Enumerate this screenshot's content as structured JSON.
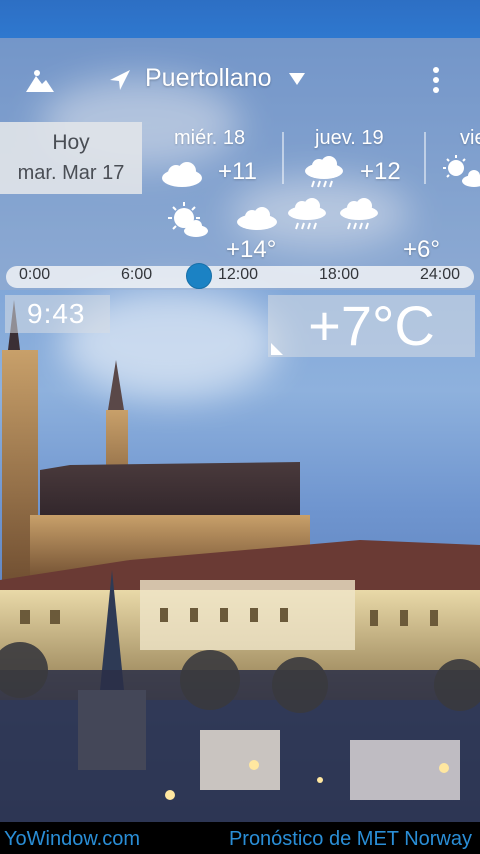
{
  "header": {
    "location": "Puertollano"
  },
  "days": [
    {
      "name": "Hoy",
      "date": "mar. Mar 17"
    },
    {
      "name": "miér. 18",
      "temp": "+11",
      "icon": "cloud-icon"
    },
    {
      "name": "juev. 19",
      "temp": "+12",
      "icon": "rain-cloud-icon"
    },
    {
      "name": "vie",
      "icon": "sun-cloud-icon"
    }
  ],
  "hourly": {
    "high_temp": "+14°",
    "low_temp": "+6°",
    "icons": [
      "sun-cloud-icon",
      "cloud-icon",
      "rain-cloud-icon",
      "rain-cloud-icon"
    ]
  },
  "timeline": {
    "ticks": [
      "0:00",
      "6:00",
      "12:00",
      "18:00",
      "24:00"
    ],
    "now_fraction": 0.4
  },
  "current": {
    "time": "9:43",
    "temperature": "+7°C"
  },
  "footer": {
    "left_link": "YoWindow.com",
    "right_text": "Pronóstico de MET Norway"
  },
  "colors": {
    "accent": "#1b82c4",
    "footer_link": "#2a8ed6",
    "status_bar": "#2f78cf"
  }
}
